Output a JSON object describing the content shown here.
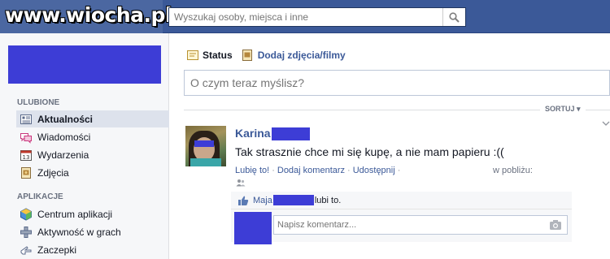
{
  "header": {
    "watermark": "www.wiocha.pl",
    "search_placeholder": "Wyszukaj osoby, miejsca i inne"
  },
  "sidebar": {
    "favorites_title": "ULUBIONE",
    "favorites": [
      {
        "label": "Aktualności",
        "icon": "news-feed-icon",
        "active": true
      },
      {
        "label": "Wiadomości",
        "icon": "messages-icon"
      },
      {
        "label": "Wydarzenia",
        "icon": "calendar-icon"
      },
      {
        "label": "Zdjęcia",
        "icon": "photos-icon"
      }
    ],
    "apps_title": "APLIKACJE",
    "apps": [
      {
        "label": "Centrum aplikacji",
        "icon": "app-center-icon"
      },
      {
        "label": "Aktywność w grach",
        "icon": "games-activity-icon"
      },
      {
        "label": "Zaczepki",
        "icon": "pokes-icon"
      }
    ]
  },
  "composer": {
    "tab_status": "Status",
    "tab_photo": "Dodaj zdjęcia/filmy",
    "placeholder": "O czym teraz myślisz?"
  },
  "feed": {
    "sort_label": "SORTUJ ▾"
  },
  "post": {
    "author": "Karina",
    "text": "Tak strasznie chce mi się kupę, a nie mam papieru :((",
    "like_action": "Lubię to!",
    "comment_action": "Dodaj komentarz",
    "share_action": "Udostępnij",
    "location": "w pobliżu:",
    "like_prefix": "Maja",
    "like_suffix": "lubi to.",
    "comment_placeholder": "Napisz komentarz..."
  },
  "colors": {
    "brand_blue": "#3b5998",
    "censor_blue": "#3d3dd6"
  }
}
